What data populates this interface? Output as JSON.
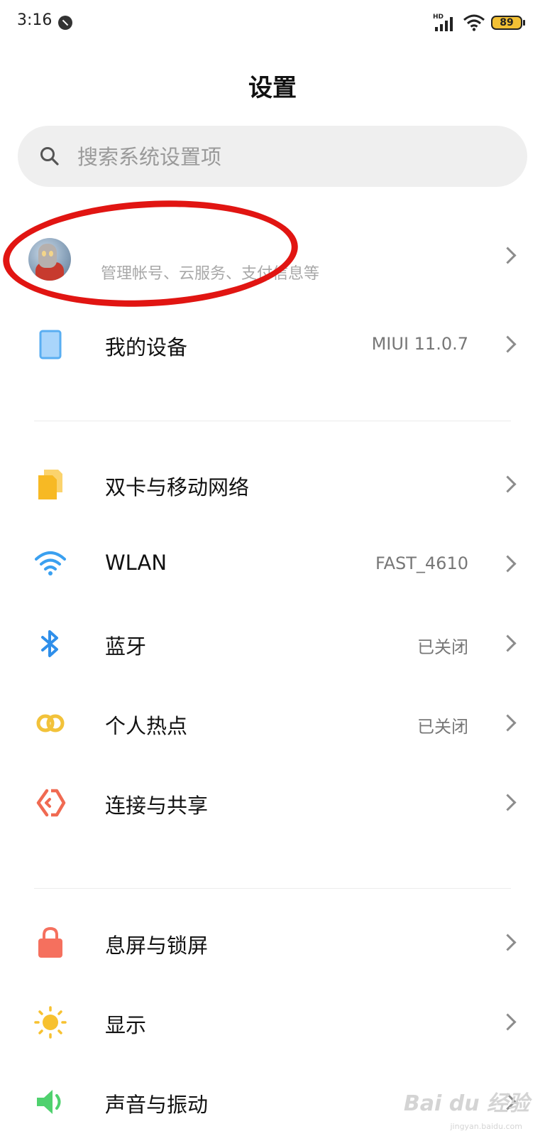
{
  "status_bar": {
    "time": "3:16",
    "network_type": "HD",
    "battery": "89"
  },
  "page": {
    "title": "设置"
  },
  "search": {
    "placeholder": "搜索系统设置项"
  },
  "account": {
    "subtitle": "管理帐号、云服务、支付信息等"
  },
  "device": {
    "label": "我的设备",
    "value": "MIUI 11.0.7"
  },
  "network_items": [
    {
      "label": "双卡与移动网络",
      "value": "",
      "icon": "sim-card-icon"
    },
    {
      "label": "WLAN",
      "value": "FAST_4610",
      "icon": "wifi-icon"
    },
    {
      "label": "蓝牙",
      "value": "已关闭",
      "icon": "bluetooth-icon"
    },
    {
      "label": "个人热点",
      "value": "已关闭",
      "icon": "hotspot-icon"
    },
    {
      "label": "连接与共享",
      "value": "",
      "icon": "share-icon"
    }
  ],
  "display_items": [
    {
      "label": "息屏与锁屏",
      "icon": "lock-icon"
    },
    {
      "label": "显示",
      "icon": "brightness-icon"
    },
    {
      "label": "声音与振动",
      "icon": "speaker-icon"
    }
  ],
  "watermark": {
    "brand": "Bai du 经验",
    "url": "jingyan.baidu.com"
  },
  "colors": {
    "annotation": "#e11512",
    "sim": "#f7b924",
    "wifi": "#3aa0f0",
    "bluetooth": "#2f8fea",
    "hotspot": "#f2c23a",
    "share": "#f06a52",
    "lock": "#f5705e",
    "display": "#f7c12f",
    "sound": "#4fd16e",
    "device": "#59aef2"
  }
}
